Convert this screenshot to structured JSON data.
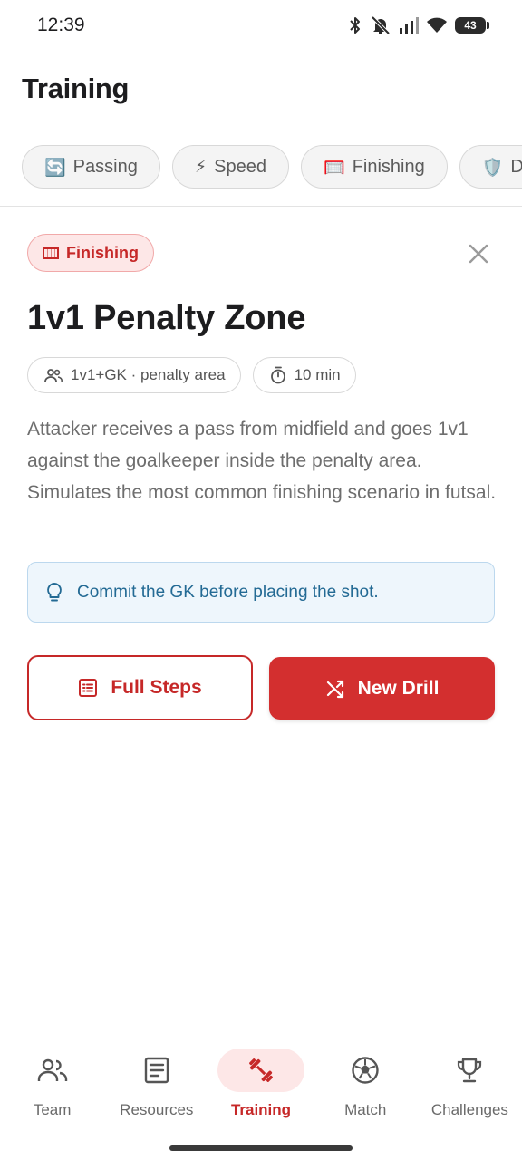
{
  "status_bar": {
    "time": "12:39",
    "battery": "43",
    "icons": [
      "bluetooth-icon",
      "bell-muted-icon",
      "signal-icon",
      "wifi-icon",
      "battery-icon"
    ]
  },
  "header": {
    "title": "Training"
  },
  "categories": [
    {
      "emoji": "🔄",
      "label": "Passing"
    },
    {
      "emoji": "⚡",
      "label": "Speed"
    },
    {
      "emoji": "🥅",
      "label": "Finishing"
    },
    {
      "emoji": "🛡️",
      "label": "De"
    }
  ],
  "drill": {
    "category_label": "Finishing",
    "title": "1v1 Penalty Zone",
    "players": "1v1+GK · penalty area",
    "duration": "10 min",
    "description": "Attacker receives a pass from midfield and goes 1v1 against the goalkeeper inside the penalty area. Simulates the most common finishing scenario in futsal.",
    "tip": "Commit the GK before placing the shot."
  },
  "actions": {
    "full_steps": "Full Steps",
    "new_drill": "New Drill"
  },
  "nav": {
    "items": [
      {
        "label": "Team",
        "icon": "team-icon"
      },
      {
        "label": "Resources",
        "icon": "resources-icon"
      },
      {
        "label": "Training",
        "icon": "dumbbell-icon"
      },
      {
        "label": "Match",
        "icon": "soccer-ball-icon"
      },
      {
        "label": "Challenges",
        "icon": "trophy-icon"
      }
    ],
    "active": "Training"
  },
  "colors": {
    "accent": "#d32f2f",
    "accent_light": "#fde7e7",
    "tip_bg": "#eef6fc",
    "tip_text": "#236a94"
  }
}
